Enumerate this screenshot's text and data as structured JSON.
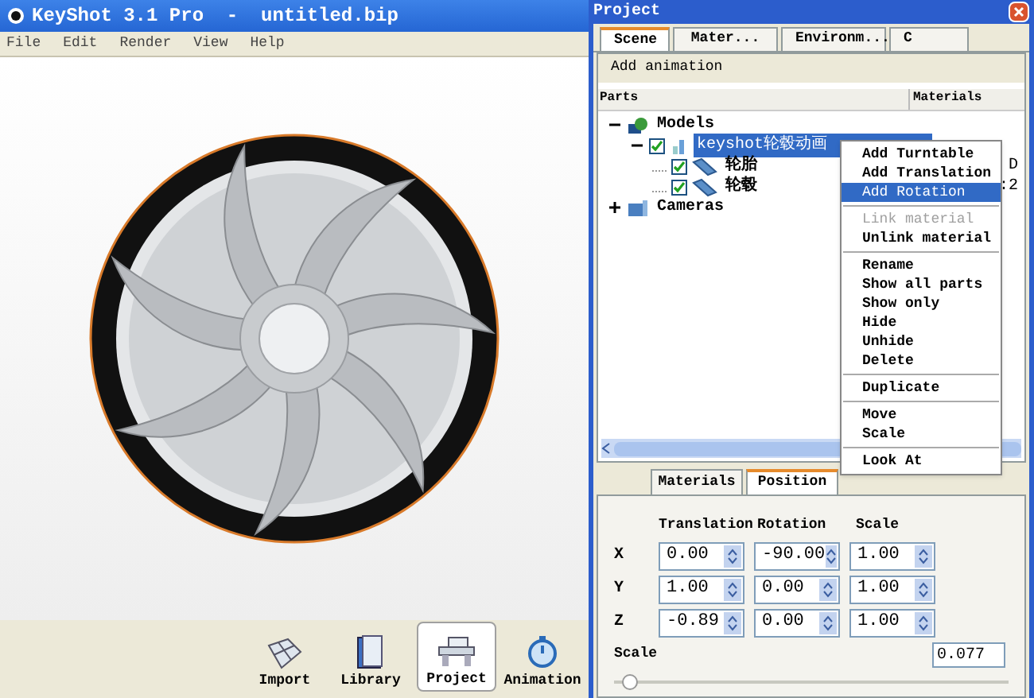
{
  "main_window": {
    "title": "KeyShot 3.1 Pro  -  untitled.bip",
    "menu": [
      "File",
      "Edit",
      "Render",
      "View",
      "Help"
    ],
    "toolbar": [
      {
        "label": "Import",
        "kind": "import",
        "selected": false
      },
      {
        "label": "Library",
        "kind": "library",
        "selected": false
      },
      {
        "label": "Project",
        "kind": "project",
        "selected": true
      },
      {
        "label": "Animation",
        "kind": "animation",
        "selected": false
      }
    ]
  },
  "project_panel": {
    "title": "Project",
    "tabs": [
      {
        "label": "Scene",
        "selected": true
      },
      {
        "label": "Mater...",
        "selected": false
      },
      {
        "label": "Environm...",
        "selected": false
      },
      {
        "label": "C",
        "selected": false
      }
    ],
    "add_animation": "Add animation",
    "columns": [
      "Parts",
      "Materials"
    ],
    "tree": [
      {
        "label": "Models",
        "kind": "models",
        "expanded": true,
        "children": [
          {
            "label": "keyshot轮毂动画",
            "kind": "model",
            "checked": true,
            "selected": true,
            "expanded": true,
            "children": [
              {
                "label": "轮胎",
                "kind": "part",
                "checked": true,
                "selected": false,
                "material": "D"
              },
              {
                "label": "轮毂",
                "kind": "part",
                "checked": true,
                "selected": false,
                "material": ":2"
              }
            ]
          }
        ]
      },
      {
        "label": "Cameras",
        "kind": "cameras",
        "expanded": false
      }
    ],
    "bottom_tabs": [
      {
        "label": "Materials",
        "selected": false
      },
      {
        "label": "Position",
        "selected": true
      }
    ],
    "position": {
      "headers": [
        "Translation",
        "Rotation",
        "Scale"
      ],
      "rows": [
        {
          "axis": "X",
          "values": [
            "0.00",
            "-90.00",
            "1.00"
          ]
        },
        {
          "axis": "Y",
          "values": [
            "1.00",
            "0.00",
            "1.00"
          ]
        },
        {
          "axis": "Z",
          "values": [
            "-0.89",
            "0.00",
            "1.00"
          ]
        }
      ],
      "scale_label": "Scale",
      "scale_value": "0.077",
      "scale_slider": {
        "level": 0.02
      }
    }
  },
  "context_menu": [
    {
      "kind": "item",
      "label": "Add Turntable",
      "disabled": false,
      "selected": false
    },
    {
      "kind": "item",
      "label": "Add Translation",
      "disabled": false,
      "selected": false
    },
    {
      "kind": "item",
      "label": "Add Rotation",
      "disabled": false,
      "selected": true
    },
    {
      "kind": "separator"
    },
    {
      "kind": "item",
      "label": "Link material",
      "disabled": true,
      "selected": false
    },
    {
      "kind": "item",
      "label": "Unlink material",
      "disabled": false,
      "selected": false
    },
    {
      "kind": "separator"
    },
    {
      "kind": "item",
      "label": "Rename",
      "disabled": false,
      "selected": false
    },
    {
      "kind": "item",
      "label": "Show all parts",
      "disabled": false,
      "selected": false
    },
    {
      "kind": "item",
      "label": "Show only",
      "disabled": false,
      "selected": false
    },
    {
      "kind": "item",
      "label": "Hide",
      "disabled": false,
      "selected": false
    },
    {
      "kind": "item",
      "label": "Unhide",
      "disabled": false,
      "selected": false
    },
    {
      "kind": "item",
      "label": "Delete",
      "disabled": false,
      "selected": false
    },
    {
      "kind": "separator"
    },
    {
      "kind": "item",
      "label": "Duplicate",
      "disabled": false,
      "selected": false
    },
    {
      "kind": "separator"
    },
    {
      "kind": "item",
      "label": "Move",
      "disabled": false,
      "selected": false
    },
    {
      "kind": "item",
      "label": "Scale",
      "disabled": false,
      "selected": false
    },
    {
      "kind": "separator"
    },
    {
      "kind": "item",
      "label": "Look At",
      "disabled": false,
      "selected": false
    }
  ]
}
